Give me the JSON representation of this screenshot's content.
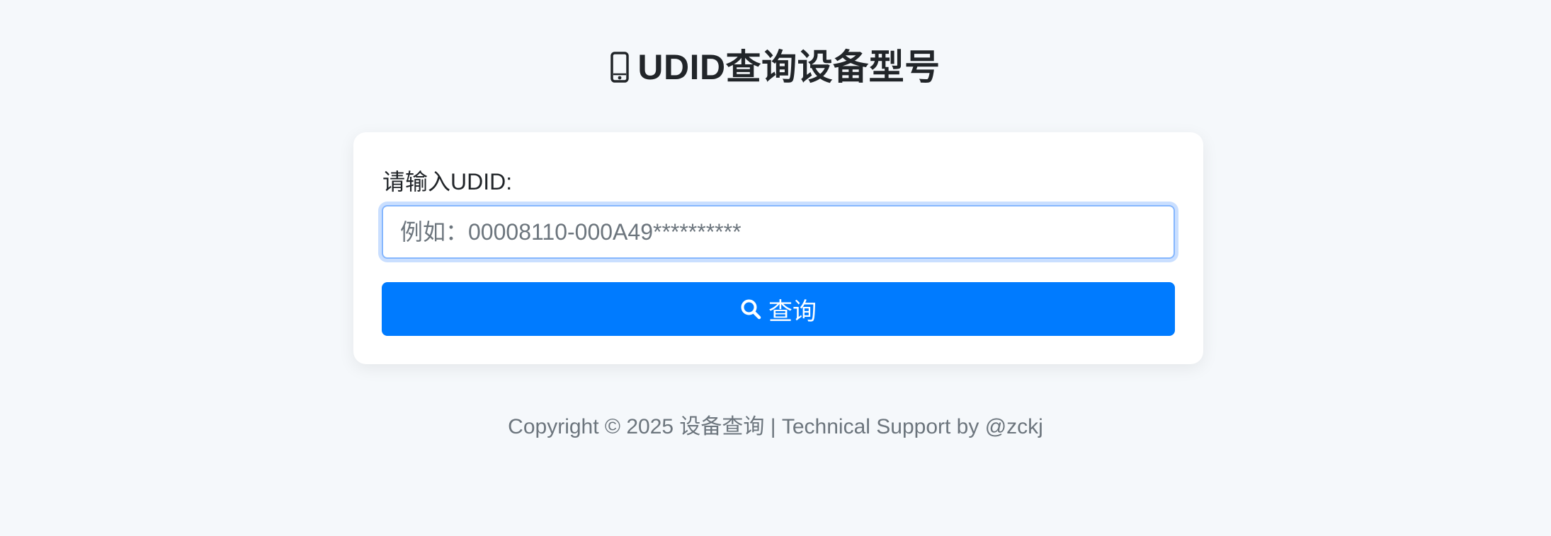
{
  "header": {
    "icon": "mobile-phone-icon",
    "title": "UDID查询设备型号"
  },
  "form": {
    "label": "请输入UDID:",
    "input_value": "",
    "input_placeholder": "例如：00008110-000A49**********",
    "button_icon": "search-icon",
    "button_label": "查询"
  },
  "footer": {
    "text": "Copyright © 2025 设备查询 | Technical Support by @zckj"
  },
  "colors": {
    "background": "#f5f8fb",
    "primary": "#007bff",
    "input_focus_border": "#86b7fe",
    "muted_text": "#6c757d"
  }
}
